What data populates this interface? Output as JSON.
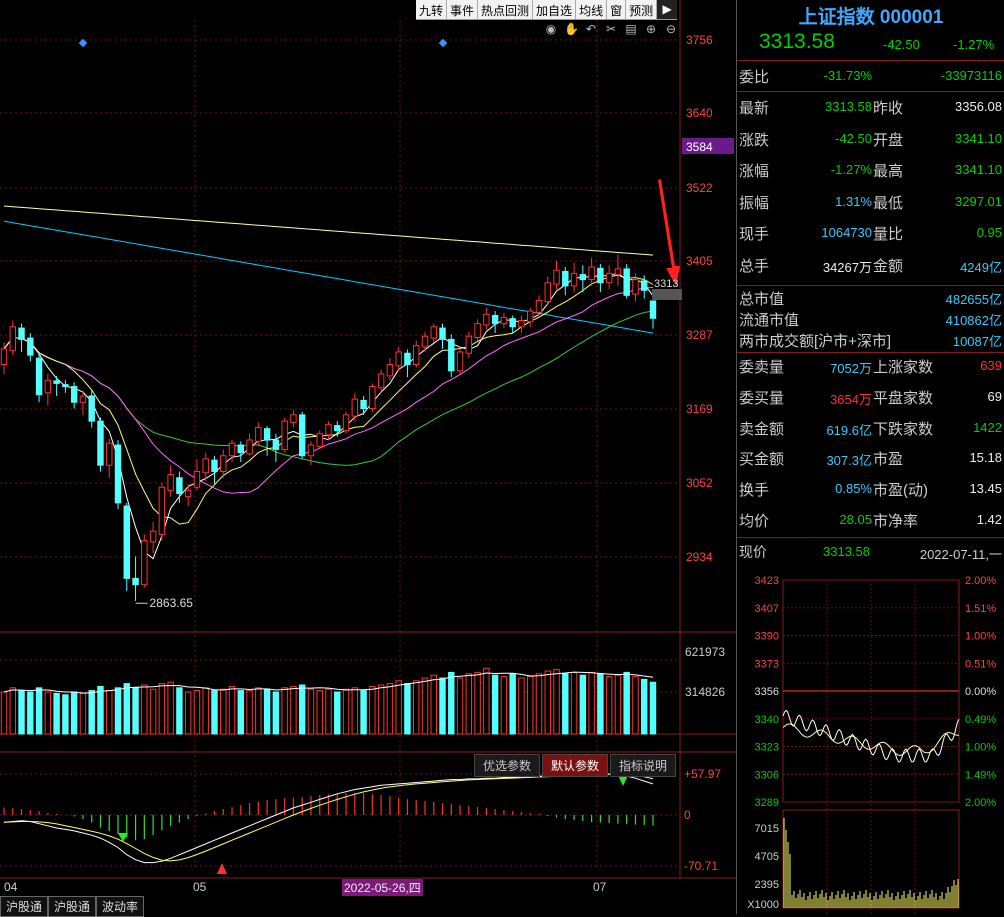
{
  "toolbar": {
    "items": [
      "九转",
      "事件",
      "热点回测",
      "加自选",
      "均线",
      "窗",
      "预测"
    ],
    "end_icon": "collapse-arrow-icon"
  },
  "chart_tools": [
    "eye-icon",
    "hand-icon",
    "undo-icon",
    "scissors-icon",
    "trash-icon",
    "zoom-in-icon",
    "zoom-out-icon"
  ],
  "colors": {
    "up": "#ff3030",
    "down": "#54ffff",
    "ma5": "#ffffff",
    "ma10": "#ffff66",
    "ma20": "#ff66ff",
    "ma60": "#33cc33",
    "ma120": "#00ccff",
    "ma250": "#ffffaa",
    "grid": "#7a1010"
  },
  "price_axis": {
    "ticks": [
      "3756",
      "3640",
      "3584",
      "3522",
      "3405",
      "3287",
      "3169",
      "3052",
      "2934"
    ],
    "current_label": "3584",
    "last_price_tag": "3313"
  },
  "low_annotation": "2863.65",
  "volume_axis": {
    "top": "621973",
    "mid": "314826"
  },
  "macd_axis": {
    "top": "+57.97",
    "zero": "0",
    "bottom": "-70.71"
  },
  "indicator_tabs": [
    "优选参数",
    "默认参数",
    "指标说明"
  ],
  "date_axis": [
    "04",
    "05",
    "07"
  ],
  "date_marker": "2022-05-26,四",
  "bottom_tabs": [
    "沪股通",
    "沪股通",
    "波动率"
  ],
  "panel": {
    "title": "上证指数 000001",
    "price": "3313.58",
    "change": "-42.50",
    "change_pct": "-1.27%",
    "weibi": {
      "label": "委比",
      "pct": "-31.73%",
      "diff": "-33973116"
    },
    "quote_rows": [
      {
        "l1": "最新",
        "v1": "3313.58",
        "c1": "g",
        "l2": "昨收",
        "v2": "3356.08",
        "c2": "w"
      },
      {
        "l1": "涨跌",
        "v1": "-42.50",
        "c1": "g",
        "l2": "开盘",
        "v2": "3341.10",
        "c2": "g"
      },
      {
        "l1": "涨幅",
        "v1": "-1.27%",
        "c1": "g",
        "l2": "最高",
        "v2": "3341.10",
        "c2": "g"
      },
      {
        "l1": "振幅",
        "v1": "1.31%",
        "c1": "c",
        "l2": "最低",
        "v2": "3297.01",
        "c2": "g"
      },
      {
        "l1": "现手",
        "v1": "1064730",
        "c1": "c",
        "l2": "量比",
        "v2": "0.95",
        "c2": "g"
      },
      {
        "l1": "总手",
        "v1": "34267万",
        "c1": "w",
        "l2": "金额",
        "v2": "4249亿",
        "c2": "c"
      }
    ],
    "market_rows": [
      {
        "label": "总市值",
        "value": "482655亿"
      },
      {
        "label": "流通市值",
        "value": "410862亿"
      },
      {
        "label": "两市成交额[沪市+深市]",
        "value": "10087亿"
      }
    ],
    "stat_rows": [
      {
        "l1": "委卖量",
        "v1": "7052万",
        "c1": "c",
        "l2": "上涨家数",
        "v2": "639",
        "c2": "r"
      },
      {
        "l1": "委买量",
        "v1": "3654万",
        "c1": "r",
        "l2": "平盘家数",
        "v2": "69",
        "c2": "w"
      },
      {
        "l1": "卖金额",
        "v1": "619.6亿",
        "c1": "c",
        "l2": "下跌家数",
        "v2": "1422",
        "c2": "g"
      },
      {
        "l1": "买金额",
        "v1": "307.3亿",
        "c1": "c",
        "l2": "市盈",
        "v2": "15.18",
        "c2": "w"
      },
      {
        "l1": "换手",
        "v1": "0.85%",
        "c1": "c",
        "l2": "市盈(动)",
        "v2": "13.45",
        "c2": "w"
      },
      {
        "l1": "均价",
        "v1": "28.05",
        "c1": "g",
        "l2": "市净率",
        "v2": "1.42",
        "c2": "w"
      }
    ],
    "now_row": {
      "label": "现价",
      "price": "3313.58",
      "date": "2022-07-11,一"
    },
    "mini_left_ticks": [
      "3423",
      "3407",
      "3390",
      "3373",
      "3356",
      "3340",
      "3323",
      "3306",
      "3289"
    ],
    "mini_right_ticks": [
      "2.00%",
      "1.51%",
      "1.00%",
      "0.51%",
      "0.00%",
      "0.49%",
      "1.00%",
      "1.49%",
      "2.00%"
    ],
    "mini_vol_ticks": [
      "7015",
      "4705",
      "2395",
      "X1000"
    ]
  },
  "chart_data": {
    "type": "candlestick",
    "price_ylim": [
      2863.65,
      3756
    ],
    "low_value": 2863.65,
    "candles": [
      [
        3240,
        3265,
        3225,
        3275
      ],
      [
        3262,
        3300,
        3255,
        3310
      ],
      [
        3298,
        3280,
        3260,
        3305
      ],
      [
        3282,
        3255,
        3245,
        3290
      ],
      [
        3250,
        3192,
        3180,
        3260
      ],
      [
        3195,
        3215,
        3175,
        3225
      ],
      [
        3214,
        3210,
        3190,
        3222
      ],
      [
        3208,
        3205,
        3195,
        3215
      ],
      [
        3205,
        3180,
        3170,
        3212
      ],
      [
        3180,
        3190,
        3160,
        3198
      ],
      [
        3190,
        3150,
        3140,
        3200
      ],
      [
        3150,
        3080,
        3070,
        3156
      ],
      [
        3080,
        3115,
        3060,
        3122
      ],
      [
        3112,
        3020,
        3010,
        3120
      ],
      [
        3015,
        2900,
        2880,
        3020
      ],
      [
        2900,
        2890,
        2864,
        2935
      ],
      [
        2890,
        2960,
        2885,
        2970
      ],
      [
        2958,
        2975,
        2940,
        2990
      ],
      [
        2970,
        3045,
        2960,
        3052
      ],
      [
        3040,
        3065,
        3030,
        3080
      ],
      [
        3060,
        3035,
        3020,
        3070
      ],
      [
        3030,
        3040,
        3015,
        3050
      ],
      [
        3045,
        3070,
        3040,
        3090
      ],
      [
        3068,
        3090,
        3055,
        3100
      ],
      [
        3088,
        3070,
        3050,
        3095
      ],
      [
        3070,
        3095,
        3060,
        3105
      ],
      [
        3095,
        3115,
        3085,
        3120
      ],
      [
        3112,
        3100,
        3085,
        3118
      ],
      [
        3098,
        3120,
        3095,
        3130
      ],
      [
        3118,
        3140,
        3110,
        3148
      ],
      [
        3138,
        3120,
        3095,
        3142
      ],
      [
        3120,
        3105,
        3085,
        3130
      ],
      [
        3105,
        3150,
        3100,
        3155
      ],
      [
        3148,
        3160,
        3140,
        3168
      ],
      [
        3160,
        3095,
        3090,
        3165
      ],
      [
        3095,
        3112,
        3080,
        3118
      ],
      [
        3110,
        3130,
        3105,
        3135
      ],
      [
        3128,
        3145,
        3120,
        3150
      ],
      [
        3143,
        3135,
        3125,
        3150
      ],
      [
        3135,
        3160,
        3130,
        3165
      ],
      [
        3158,
        3185,
        3150,
        3195
      ],
      [
        3183,
        3170,
        3160,
        3190
      ],
      [
        3170,
        3205,
        3165,
        3210
      ],
      [
        3203,
        3225,
        3195,
        3232
      ],
      [
        3222,
        3240,
        3215,
        3250
      ],
      [
        3238,
        3260,
        3230,
        3268
      ],
      [
        3258,
        3240,
        3220,
        3264
      ],
      [
        3240,
        3270,
        3235,
        3278
      ],
      [
        3268,
        3285,
        3260,
        3292
      ],
      [
        3282,
        3300,
        3275,
        3305
      ],
      [
        3298,
        3280,
        3265,
        3305
      ],
      [
        3280,
        3230,
        3220,
        3288
      ],
      [
        3230,
        3260,
        3225,
        3265
      ],
      [
        3258,
        3285,
        3250,
        3292
      ],
      [
        3283,
        3305,
        3278,
        3312
      ],
      [
        3303,
        3320,
        3295,
        3330
      ],
      [
        3318,
        3305,
        3290,
        3325
      ],
      [
        3305,
        3315,
        3298,
        3322
      ],
      [
        3313,
        3300,
        3290,
        3318
      ],
      [
        3300,
        3310,
        3290,
        3318
      ],
      [
        3308,
        3325,
        3300,
        3330
      ],
      [
        3323,
        3342,
        3318,
        3350
      ],
      [
        3340,
        3370,
        3335,
        3380
      ],
      [
        3368,
        3390,
        3360,
        3405
      ],
      [
        3388,
        3365,
        3350,
        3395
      ],
      [
        3365,
        3385,
        3355,
        3402
      ],
      [
        3383,
        3375,
        3355,
        3398
      ],
      [
        3375,
        3395,
        3365,
        3410
      ],
      [
        3393,
        3370,
        3355,
        3400
      ],
      [
        3370,
        3385,
        3360,
        3398
      ],
      [
        3383,
        3392,
        3365,
        3415
      ],
      [
        3392,
        3350,
        3345,
        3400
      ],
      [
        3352,
        3375,
        3340,
        3385
      ],
      [
        3373,
        3358,
        3345,
        3382
      ],
      [
        3341.1,
        3313.58,
        3297.01,
        3341.1
      ]
    ],
    "volumes": [
      0.3,
      0.33,
      0.31,
      0.3,
      0.33,
      0.3,
      0.29,
      0.28,
      0.3,
      0.29,
      0.31,
      0.34,
      0.31,
      0.33,
      0.36,
      0.33,
      0.35,
      0.32,
      0.36,
      0.37,
      0.33,
      0.3,
      0.31,
      0.33,
      0.31,
      0.32,
      0.34,
      0.31,
      0.31,
      0.33,
      0.32,
      0.3,
      0.33,
      0.34,
      0.35,
      0.32,
      0.31,
      0.32,
      0.3,
      0.32,
      0.33,
      0.31,
      0.34,
      0.35,
      0.36,
      0.38,
      0.36,
      0.38,
      0.4,
      0.42,
      0.4,
      0.44,
      0.4,
      0.43,
      0.44,
      0.47,
      0.42,
      0.41,
      0.43,
      0.4,
      0.41,
      0.43,
      0.45,
      0.46,
      0.43,
      0.44,
      0.42,
      0.44,
      0.43,
      0.41,
      0.42,
      0.44,
      0.41,
      0.39,
      0.37
    ],
    "macd_hist": [
      15,
      14,
      12,
      10,
      8,
      4,
      2,
      0,
      -3,
      -8,
      -15,
      -25,
      -32,
      -38,
      -45,
      -50,
      -48,
      -40,
      -30,
      -22,
      -15,
      -8,
      -2,
      3,
      8,
      12,
      16,
      20,
      24,
      27,
      30,
      32,
      34,
      35,
      36,
      38,
      40,
      42,
      43,
      44,
      45,
      44,
      42,
      40,
      38,
      35,
      32,
      30,
      28,
      26,
      24,
      22,
      20,
      18,
      16,
      14,
      12,
      10,
      8,
      6,
      4,
      2,
      -2,
      -5,
      -8,
      -10,
      -12,
      -14,
      -15,
      -16,
      -17,
      -18,
      -19,
      -20,
      -21
    ],
    "dif": [
      -10,
      -9,
      -8,
      -9,
      -12,
      -15,
      -18,
      -20,
      -22,
      -25,
      -28,
      -32,
      -38,
      -45,
      -55,
      -62,
      -66,
      -66,
      -64,
      -60,
      -55,
      -50,
      -45,
      -40,
      -35,
      -30,
      -25,
      -20,
      -15,
      -10,
      -5,
      0,
      5,
      10,
      14,
      18,
      22,
      26,
      30,
      33,
      36,
      38,
      40,
      42,
      43,
      44,
      45,
      46,
      47,
      48,
      49,
      50,
      50,
      51,
      51,
      52,
      52,
      53,
      53,
      54,
      54,
      55,
      55,
      56,
      56,
      57,
      57,
      57.5,
      57.9,
      57.97,
      57,
      55,
      52,
      48,
      44
    ]
  }
}
